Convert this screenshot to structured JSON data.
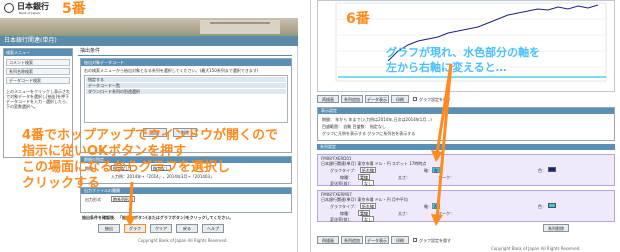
{
  "left": {
    "logo_text": "日本銀行",
    "logo_sub": "Bank of Japan",
    "step_number": "5番",
    "header_title": "日本銀行関連(単月)",
    "sidebar_title": "検索メニュー",
    "sidebar_items": [
      "コメント検索",
      "系列名称検索",
      "データコード検索"
    ],
    "sidebar_note_lines": [
      "上のメニューをクリックし表示された画面",
      "で対象データを選択し[抽出]を押下し",
      "データコードを入力・選択したら、",
      "下の変数選択へ。"
    ],
    "main_title": "抽出条件",
    "list_header": "抽出対象データコード",
    "list_note": "右の検索メニューから抽出対象となる系列を選択してください。(最大150系列まで選択できます)",
    "list_rows": [
      "指定する",
      "データコード一覧",
      "ダウンロード系列の別途選択"
    ],
    "add_button": "追加",
    "delete_button": "削除",
    "section2_title": "期間の指定",
    "period_label": "期間",
    "period_from": "指定なし",
    "period_to": "指定なし",
    "period_note": "入力例：2014年→「2014」，2014年3月→「201403」",
    "section3_title": "出力ファイルの種類",
    "output_label": "出力形式",
    "output_value": "時系列形式",
    "output_note": "抽出条件を確認後、「抽出」ボタン(またはグラフボタン)をクリックしてください。",
    "buttons": [
      "抽出",
      "グラフ",
      "クリア",
      "戻る",
      "ヘルプ"
    ],
    "copyright": "Copyright Bank of Japan All Rights Reserved.",
    "callout_lines": [
      "4番でホップアップでウインドウが開くので",
      "指示に従いOKボタンを押す",
      "この場面になるからグラフを選択し",
      "クリックする"
    ]
  },
  "right": {
    "step_number": "6番",
    "blue_caption_lines": [
      "グラフが現れ、水色部分の軸を",
      "左から右軸に変えると…"
    ],
    "tabs": [
      "再描画",
      "系列追加",
      "データ表示",
      "印刷"
    ],
    "tab_note": "グラフ設定を隠す",
    "display_title": "表示設定",
    "period_row": "期間：  年から  年まで(入力例は2014年,日次は2014年1月…)",
    "axis_row": "目盛範囲：  自動  目盛数：  指定なし",
    "legend_row": "グラフに凡例を表示する  グラフに系列名を表示する",
    "series_title": "系列設定",
    "series_rows": [
      {
        "code": "FM08'FXERD01",
        "desc": "日本銀行関連(単月) 東京市場 ドル・円 スポット 17時時点",
        "type_label": "グラフタイプ：",
        "type_value": "折れ線",
        "axis_label": "軸：",
        "axis_value": "左",
        "color_label": "色：",
        "line_label": "線種：",
        "line_value": "実線",
        "width_label": "太さ：",
        "mark_label": "マーク：",
        "change_label": "変化率(前)：",
        "change_value": "なし"
      },
      {
        "code": "FM08'FXERM07",
        "desc": "日本銀行関連(単月) 東京市場 ドル・円 月中平均",
        "type_label": "グラフタイプ：",
        "type_value": "折れ線",
        "axis_label": "軸：",
        "axis_value": "左",
        "color_label": "色：",
        "line_label": "線種：",
        "line_value": "実線",
        "width_label": "太さ：",
        "mark_label": "マーク：",
        "change_label": "変化率(前)：",
        "change_value": "なし"
      }
    ],
    "apply_button": "系列削除",
    "copyright": "Copyright Bank of Japan All Rights Reserved."
  }
}
